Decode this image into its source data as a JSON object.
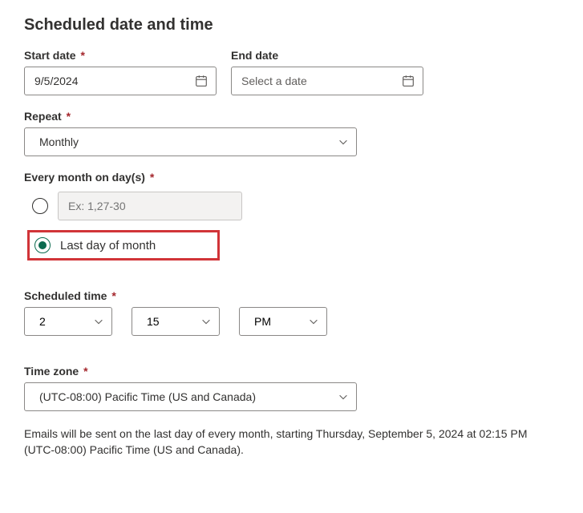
{
  "section_title": "Scheduled date and time",
  "start_date": {
    "label": "Start date",
    "required": "*",
    "value": "9/5/2024"
  },
  "end_date": {
    "label": "End date",
    "placeholder": "Select a date"
  },
  "repeat": {
    "label": "Repeat",
    "required": "*",
    "value": "Monthly"
  },
  "every_month": {
    "label": "Every month on day(s)",
    "required": "*",
    "option_days_placeholder": "Ex: 1,27-30",
    "option_last_day": "Last day of month"
  },
  "scheduled_time": {
    "label": "Scheduled time",
    "required": "*",
    "hour": "2",
    "minute": "15",
    "ampm": "PM"
  },
  "time_zone": {
    "label": "Time zone",
    "required": "*",
    "value": "(UTC-08:00) Pacific Time (US and Canada)"
  },
  "summary": "Emails will be sent on the last day of every month, starting Thursday, September 5, 2024 at 02:15 PM (UTC-08:00) Pacific Time (US and Canada)."
}
